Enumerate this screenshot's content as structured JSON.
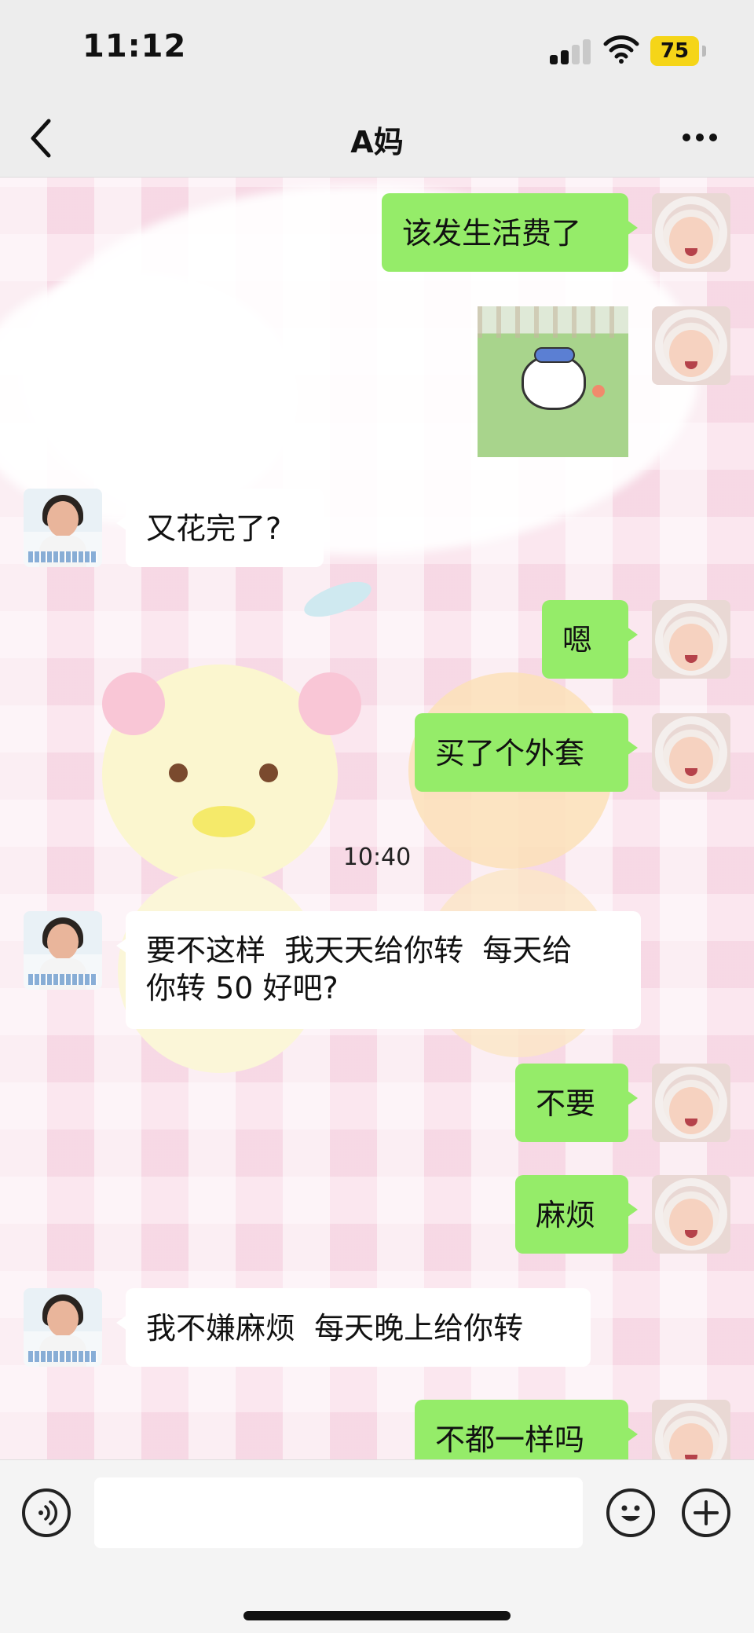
{
  "status_bar": {
    "time": "11:12",
    "battery": "75"
  },
  "header": {
    "title": "A妈"
  },
  "messages": [
    {
      "side": "out",
      "text": "该发生活费了"
    },
    {
      "side": "out",
      "type": "sticker",
      "icon": "cat-sticker"
    },
    {
      "side": "in",
      "text": "又花完了?"
    },
    {
      "side": "out",
      "text": "嗯"
    },
    {
      "side": "out",
      "text": "买了个外套"
    },
    {
      "type": "timestamp",
      "text": "10:40"
    },
    {
      "side": "in",
      "text": "要不这样  我天天给你转  每天给\n你转 50 好吧?"
    },
    {
      "side": "out",
      "text": "不要"
    },
    {
      "side": "out",
      "text": "麻烦"
    },
    {
      "side": "in",
      "text": "我不嫌麻烦  每天晚上给你转"
    },
    {
      "side": "out",
      "text": "不都一样吗"
    }
  ],
  "input_bar": {
    "placeholder": "",
    "icons": [
      "voice-icon",
      "emoji-icon",
      "plus-icon"
    ]
  },
  "colors": {
    "outgoing_bubble": "#95ec69",
    "incoming_bubble": "#ffffff",
    "battery": "#f5d518",
    "chat_background": "#fbe7ef"
  }
}
